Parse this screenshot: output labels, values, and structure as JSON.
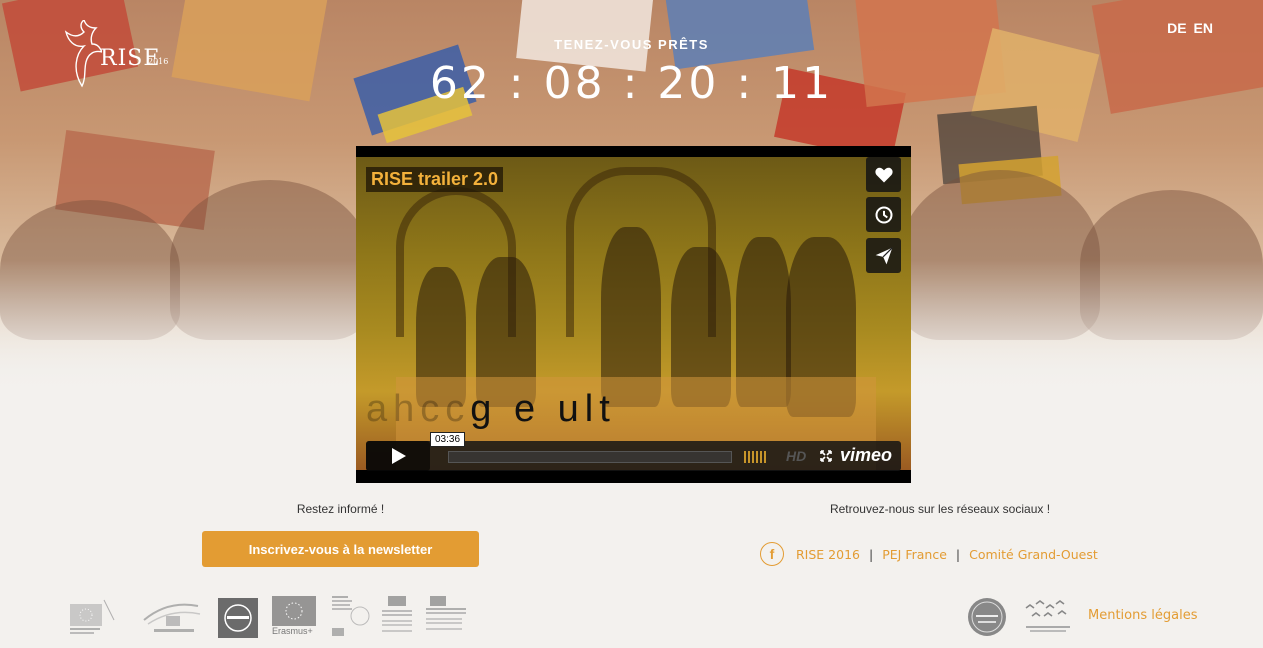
{
  "brand": {
    "name": "RISE",
    "year": "2016"
  },
  "languages": [
    "DE",
    "EN"
  ],
  "countdown": {
    "label": "TENEZ-VOUS PRÊTS",
    "value": "62 : 08 : 20 : 11"
  },
  "video": {
    "title": "RISE trailer 2.0",
    "caption": "g e ult",
    "caption_ghost": "ahcc",
    "timestamp": "03:36",
    "hd_label": "HD",
    "provider": "vimeo",
    "side_buttons": [
      "heart-icon",
      "clock-icon",
      "send-icon"
    ]
  },
  "newsletter": {
    "heading": "Restez informé !",
    "button_label": "Inscrivez-vous à la newsletter"
  },
  "social": {
    "heading": "Retrouvez-nous sur les réseaux sociaux !",
    "fb_glyph": "f",
    "links": [
      "RISE 2016",
      "PEJ France",
      "Comité Grand-Ouest"
    ]
  },
  "partner_logos": [
    "eu-commission-logo",
    "parliament-logo",
    "footer-logo-3",
    "erasmus-logo",
    "ministere-logo",
    "republique-logo",
    "ministere-2-logo"
  ],
  "partner_text": {
    "erasmus": "Erasmus+"
  },
  "footer": {
    "mentions": "Mentions légales"
  },
  "colors": {
    "accent": "#e39c33",
    "background": "#f3f1ee"
  }
}
